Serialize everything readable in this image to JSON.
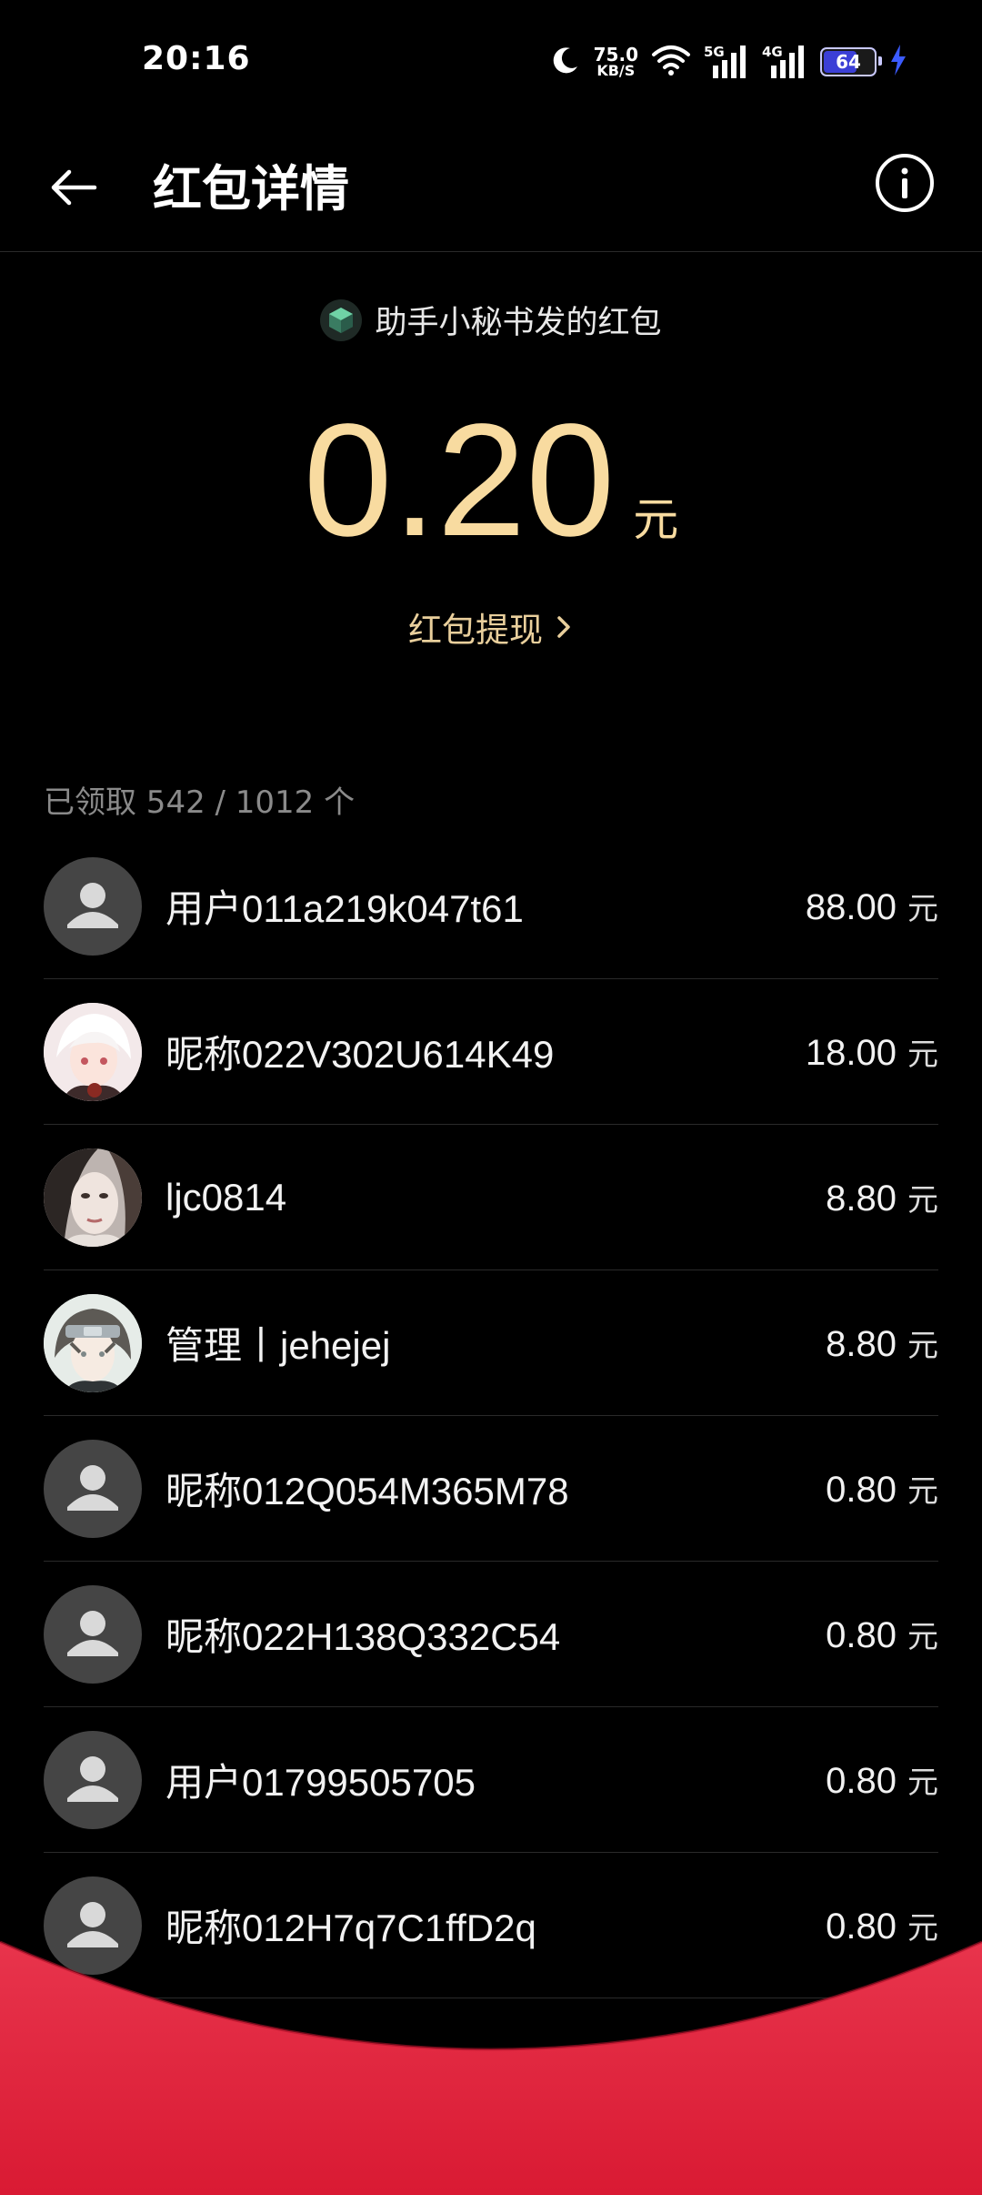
{
  "status_bar": {
    "time": "20:16",
    "net_speed_value": "75.0",
    "net_speed_unit": "KB/S",
    "sim1": "5G",
    "sim2": "4G",
    "battery": "64"
  },
  "header": {
    "title": "红包详情"
  },
  "packet": {
    "sender_text": "助手小秘书发的红包",
    "amount": "0.20",
    "unit": "元",
    "withdraw_label": "红包提现"
  },
  "received_summary": "已领取 542 / 1012 个",
  "recipients": [
    {
      "name": "用户011a219k047t61",
      "amount": "88.00",
      "unit": "元",
      "avatar": "default-avatar"
    },
    {
      "name": "昵称022V302U614K49",
      "amount": "18.00",
      "unit": "元",
      "avatar": "anime-white-hair"
    },
    {
      "name": "ljc0814",
      "amount": "8.80",
      "unit": "元",
      "avatar": "selfie-photo"
    },
    {
      "name": "管理丨jehejej",
      "amount": "8.80",
      "unit": "元",
      "avatar": "anime-headband"
    },
    {
      "name": "昵称012Q054M365M78",
      "amount": "0.80",
      "unit": "元",
      "avatar": "default-avatar"
    },
    {
      "name": "昵称022H138Q332C54",
      "amount": "0.80",
      "unit": "元",
      "avatar": "default-avatar"
    },
    {
      "name": "用户01799505705",
      "amount": "0.80",
      "unit": "元",
      "avatar": "default-avatar"
    },
    {
      "name": "昵称012H7q7C1ffD2q",
      "amount": "0.80",
      "unit": "元",
      "avatar": "default-avatar"
    }
  ],
  "colors": {
    "background": "#000000",
    "amount_gold": "#f8dba0",
    "withdraw_gold": "#e9cf9c",
    "overlay_red": "#e8273f",
    "battery_fill": "#3b3fd6"
  }
}
